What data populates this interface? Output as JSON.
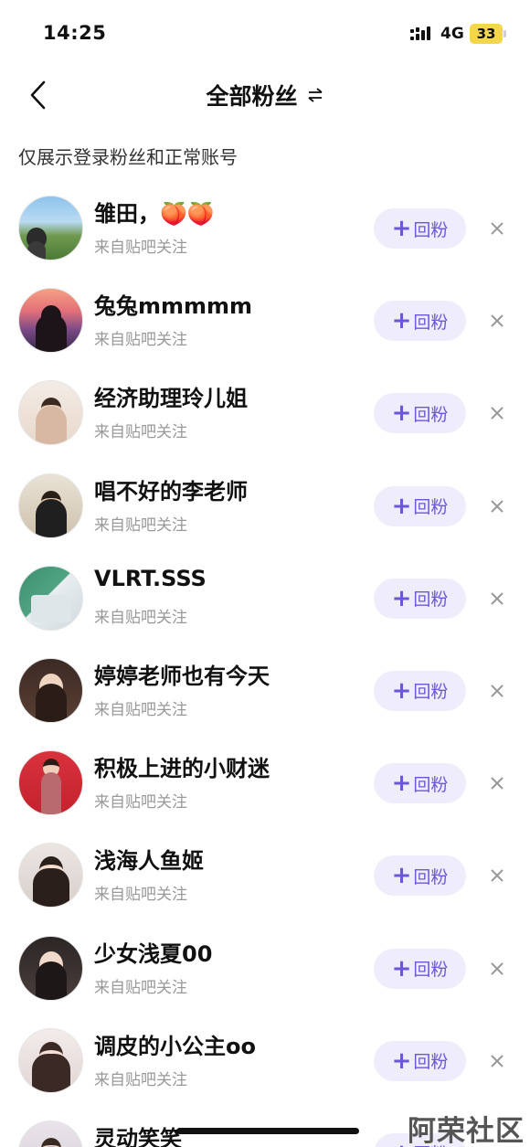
{
  "status_bar": {
    "time": "14:25",
    "network": "4G",
    "battery": "33",
    "icons": [
      "signal-icon",
      "battery-icon"
    ]
  },
  "header": {
    "title": "全部粉丝",
    "back_icon": "chevron-left-icon",
    "switch_icon": "swap-arrows-icon"
  },
  "notice": "仅展示登录粉丝和正常账号",
  "button_labels": {
    "follow_back": "回粉",
    "plus": "+"
  },
  "fans": [
    {
      "name": "雏田，🍑🍑",
      "source": "来自贴吧关注"
    },
    {
      "name": "兔兔mmmmm",
      "source": "来自贴吧关注"
    },
    {
      "name": "经济助理玲儿姐",
      "source": "来自贴吧关注"
    },
    {
      "name": "唱不好的李老师",
      "source": "来自贴吧关注"
    },
    {
      "name": "VLRT.SSS",
      "source": "来自贴吧关注"
    },
    {
      "name": "婷婷老师也有今天",
      "source": "来自贴吧关注"
    },
    {
      "name": "积极上进的小财迷",
      "source": "来自贴吧关注"
    },
    {
      "name": "浅海人鱼姬",
      "source": "来自贴吧关注"
    },
    {
      "name": "少女浅夏00",
      "source": "来自贴吧关注"
    },
    {
      "name": "调皮的小公主oo",
      "source": "来自贴吧关注"
    },
    {
      "name": "灵动笑笑",
      "source": ""
    }
  ],
  "colors": {
    "accent": "#6b58d8",
    "button_bg": "#efedfb",
    "secondary_text": "#999999"
  },
  "watermark": "阿荣社区"
}
